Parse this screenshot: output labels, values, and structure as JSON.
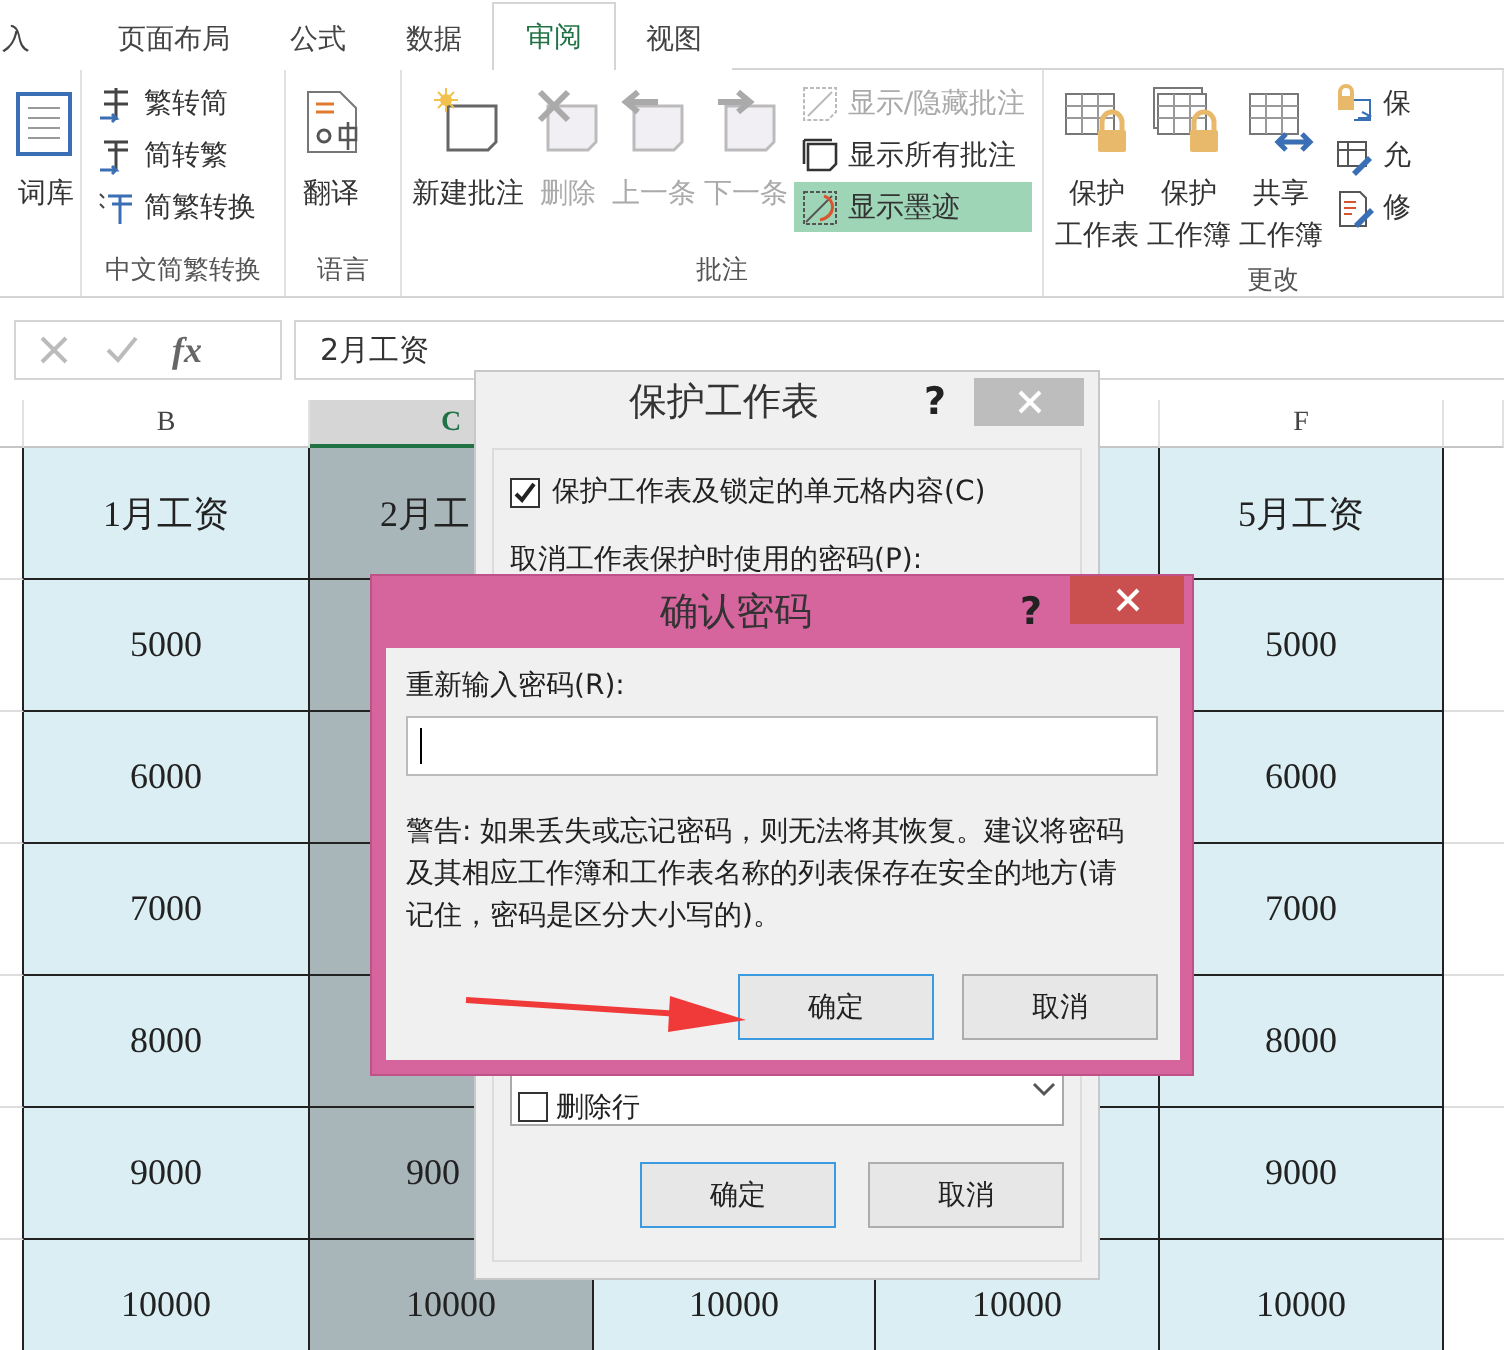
{
  "ribbon_tabs": [
    {
      "label": "入",
      "selected": false
    },
    {
      "label": "页面布局",
      "selected": false
    },
    {
      "label": "公式",
      "selected": false
    },
    {
      "label": "数据",
      "selected": false
    },
    {
      "label": "审阅",
      "selected": true
    },
    {
      "label": "视图",
      "selected": false
    }
  ],
  "ribbon_groups": [
    {
      "items": [
        {
          "kind": "large",
          "label_lines": [
            "词库"
          ],
          "disabled": false,
          "selected": false
        }
      ]
    },
    {
      "label": "中文简繁转换",
      "items": [
        {
          "kind": "small",
          "label": "繁转简",
          "disabled": false,
          "selected": false
        },
        {
          "kind": "small",
          "label": "简转繁",
          "disabled": false,
          "selected": false
        },
        {
          "kind": "small",
          "label": "简繁转换",
          "disabled": false,
          "selected": false
        }
      ]
    },
    {
      "label": "语言",
      "items": [
        {
          "kind": "large",
          "label_lines": [
            "翻译"
          ],
          "disabled": false,
          "selected": false
        }
      ]
    },
    {
      "label": "批注",
      "items": [
        {
          "kind": "large",
          "label_lines": [
            "新建批注"
          ],
          "disabled": false,
          "selected": false
        },
        {
          "kind": "large",
          "label_lines": [
            "删除"
          ],
          "disabled": true,
          "selected": false
        },
        {
          "kind": "large",
          "label_lines": [
            "上一条"
          ],
          "disabled": true,
          "selected": false
        },
        {
          "kind": "large",
          "label_lines": [
            "下一条"
          ],
          "disabled": true,
          "selected": false
        },
        {
          "kind": "small",
          "label": "显示/隐藏批注",
          "disabled": true,
          "selected": false
        },
        {
          "kind": "small",
          "label": "显示所有批注",
          "disabled": false,
          "selected": false
        },
        {
          "kind": "small",
          "label": "显示墨迹",
          "disabled": false,
          "selected": true
        }
      ]
    },
    {
      "label": "更改",
      "items": [
        {
          "kind": "large",
          "label_lines": [
            "保护",
            "工作表"
          ],
          "disabled": false,
          "selected": false
        },
        {
          "kind": "large",
          "label_lines": [
            "保护",
            "工作簿"
          ],
          "disabled": false,
          "selected": false
        },
        {
          "kind": "large",
          "label_lines": [
            "共享",
            "工作簿"
          ],
          "disabled": false,
          "selected": false
        },
        {
          "kind": "small",
          "label": "保",
          "disabled": false,
          "selected": false
        },
        {
          "kind": "small",
          "label": "允",
          "disabled": false,
          "selected": false
        },
        {
          "kind": "small",
          "label": "修",
          "disabled": false,
          "selected": false
        }
      ]
    }
  ],
  "formula_bar": {
    "function_label": "fx",
    "value": "2月工资"
  },
  "sheet": {
    "columns": [
      {
        "label": "B",
        "selected": false
      },
      {
        "label": "C",
        "selected": true
      },
      {},
      {},
      {
        "label": "F",
        "selected": false
      }
    ],
    "rows": [
      {
        "cells": [
          "1月工资",
          "2月工",
          null,
          null,
          "5月工资"
        ]
      },
      {
        "cells": [
          "5000",
          null,
          null,
          null,
          "5000"
        ]
      },
      {
        "cells": [
          "6000",
          null,
          null,
          null,
          "6000"
        ]
      },
      {
        "cells": [
          "7000",
          null,
          null,
          null,
          "7000"
        ]
      },
      {
        "cells": [
          "8000",
          null,
          null,
          null,
          "8000"
        ]
      },
      {
        "cells": [
          "9000",
          "900",
          null,
          null,
          "9000"
        ]
      },
      {
        "cells": [
          "10000",
          "10000",
          "10000",
          "10000",
          "10000"
        ]
      }
    ]
  },
  "protect_dialog": {
    "title": "保护工作表",
    "help": "?",
    "protect_option": {
      "label": "保护工作表及锁定的单元格内容(C)",
      "checked": true
    },
    "password_label": "取消工作表保护时使用的密码(P):",
    "permissions": [
      {
        "label": "删除行",
        "checked": false
      }
    ],
    "buttons": [
      {
        "label": "确定",
        "focused": true
      },
      {
        "label": "取消",
        "focused": false
      }
    ]
  },
  "confirm_dialog": {
    "title": "确认密码",
    "help": "?",
    "field_label": "重新输入密码(R):",
    "warning": "警告: 如果丢失或忘记密码，则无法将其恢复。建议将密码及其相应工作簿和工作表名称的列表保存在安全的地方(请记住，密码是区分大小写的)。",
    "buttons": [
      {
        "label": "确定",
        "focused": true
      },
      {
        "label": "取消",
        "focused": false
      }
    ]
  }
}
